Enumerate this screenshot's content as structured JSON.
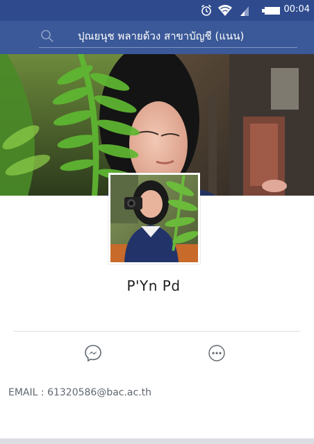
{
  "status_bar": {
    "time": "00:04",
    "icons": [
      "alarm-icon",
      "wifi-icon",
      "signal-icon",
      "battery-icon"
    ],
    "background": "#2f4b8e"
  },
  "header": {
    "search_icon": "search-icon",
    "search_text": "ปุณยนุช พลายด้วง สาขาบัญชี (แนน)",
    "background": "#3b5998"
  },
  "profile": {
    "cover_photo": "cover-photo",
    "profile_photo": "profile-photo",
    "name": "P'Yn Pd"
  },
  "actions": [
    {
      "icon": "messenger-icon"
    },
    {
      "icon": "more-icon"
    }
  ],
  "details": {
    "email_label": "EMAIL",
    "email_separator": " : ",
    "email_value": "61320586@bac.ac.th"
  }
}
